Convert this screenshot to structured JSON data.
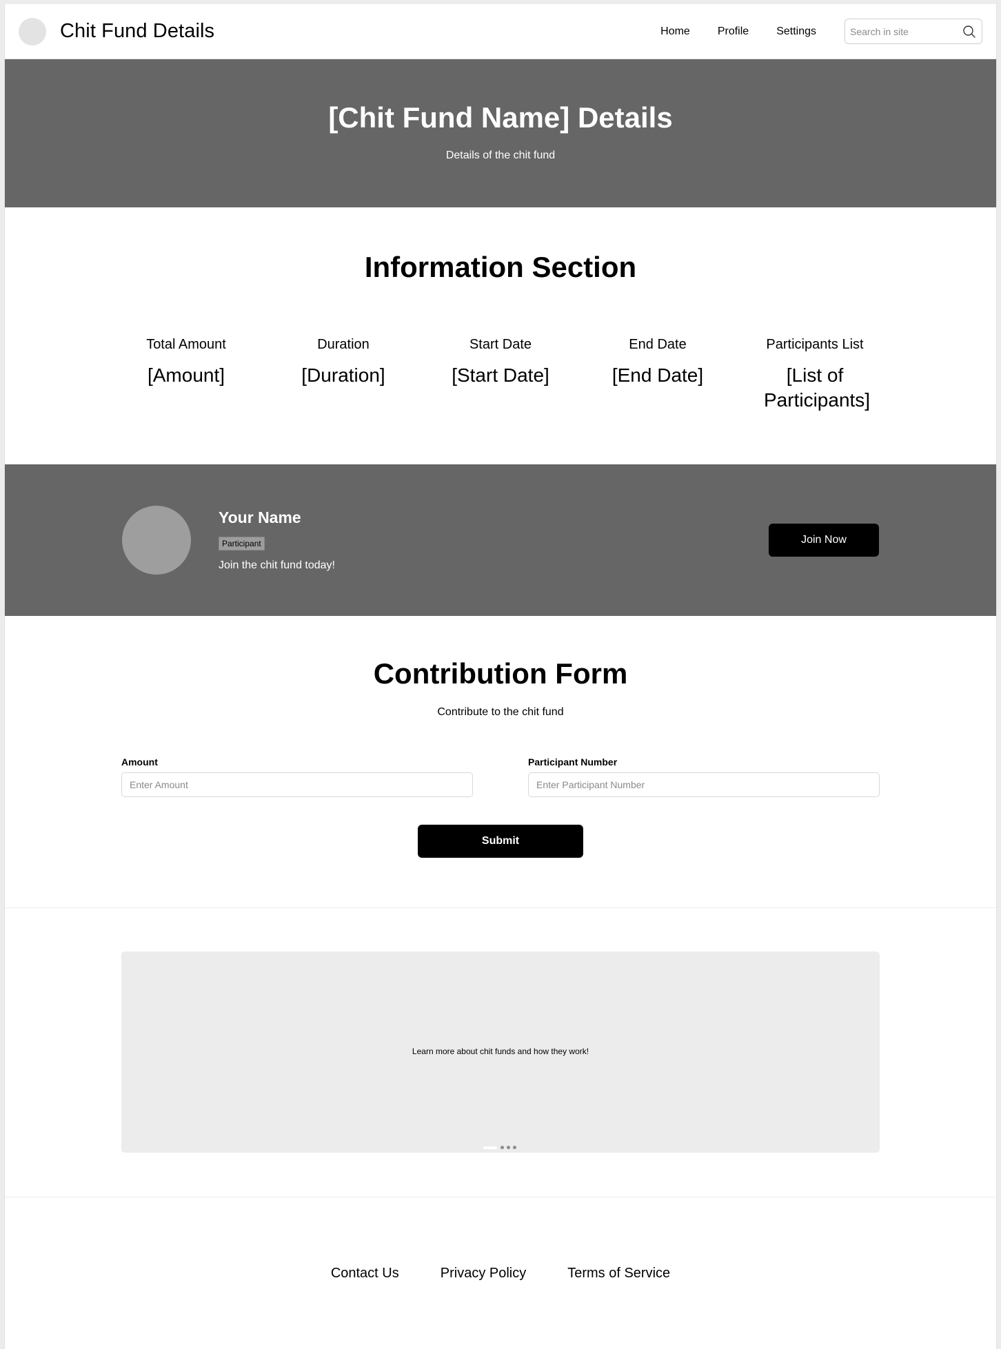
{
  "header": {
    "title": "Chit Fund Details",
    "nav": [
      "Home",
      "Profile",
      "Settings"
    ],
    "search_placeholder": "Search in site"
  },
  "hero": {
    "title": "[Chit Fund Name] Details",
    "subtitle": "Details of the chit fund"
  },
  "info": {
    "title": "Information Section",
    "stats": [
      {
        "label": "Total Amount",
        "value": "[Amount]"
      },
      {
        "label": "Duration",
        "value": "[Duration]"
      },
      {
        "label": "Start Date",
        "value": "[Start Date]"
      },
      {
        "label": "End Date",
        "value": "[End Date]"
      },
      {
        "label": "Participants List",
        "value": "[List of Participants]"
      }
    ]
  },
  "profile": {
    "name": "Your Name",
    "badge": "Participant",
    "tagline": "Join the chit fund today!",
    "join_label": "Join Now"
  },
  "contribution": {
    "title": "Contribution Form",
    "subtitle": "Contribute to the chit fund",
    "amount_label": "Amount",
    "amount_placeholder": "Enter Amount",
    "participant_label": "Participant Number",
    "participant_placeholder": "Enter Participant Number",
    "submit_label": "Submit"
  },
  "carousel": {
    "slide_text": "Learn more about chit funds and how they work!",
    "slide_count": 4,
    "active_slide": 1
  },
  "footer": {
    "links": [
      "Contact Us",
      "Privacy Policy",
      "Terms of Service"
    ]
  },
  "icons": {
    "search": "search-icon",
    "logo": "logo-circle-icon"
  },
  "colors": {
    "band": "#666666",
    "button": "#000000",
    "carousel_bg": "#ececec"
  }
}
